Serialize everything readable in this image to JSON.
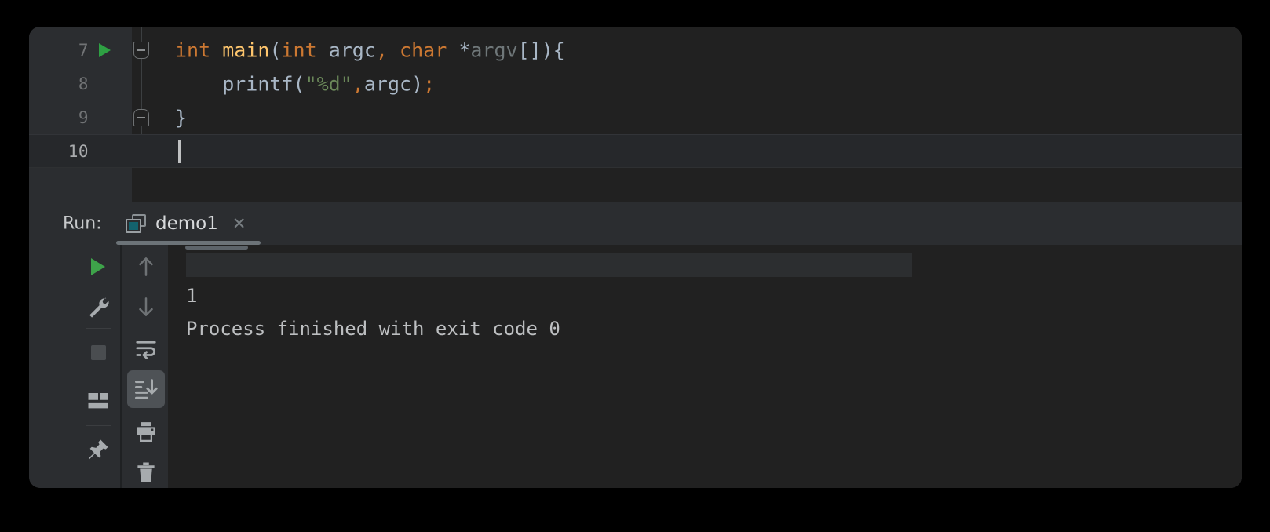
{
  "editor": {
    "lines": [
      {
        "number": "7",
        "has_run_marker": true,
        "fold": "top",
        "current": false,
        "tokens": [
          {
            "text": "int ",
            "style": "kw"
          },
          {
            "text": "main",
            "style": "fn"
          },
          {
            "text": "(",
            "style": "txt"
          },
          {
            "text": "int",
            "style": "kw"
          },
          {
            "text": " argc",
            "style": "txt"
          },
          {
            "text": ",",
            "style": "kw"
          },
          {
            "text": " ",
            "style": "txt"
          },
          {
            "text": "char",
            "style": "kw"
          },
          {
            "text": " *",
            "style": "txt"
          },
          {
            "text": "argv",
            "style": "dim"
          },
          {
            "text": "[]){",
            "style": "txt"
          }
        ]
      },
      {
        "number": "8",
        "has_run_marker": false,
        "fold": "",
        "current": false,
        "indent": 4,
        "tokens": [
          {
            "text": "    printf(",
            "style": "txt"
          },
          {
            "text": "\"%d\"",
            "style": "str"
          },
          {
            "text": ",",
            "style": "kw"
          },
          {
            "text": "argc)",
            "style": "txt"
          },
          {
            "text": ";",
            "style": "kw"
          }
        ]
      },
      {
        "number": "9",
        "has_run_marker": false,
        "fold": "bottom",
        "current": false,
        "tokens": [
          {
            "text": "}",
            "style": "txt"
          }
        ]
      },
      {
        "number": "10",
        "has_run_marker": false,
        "fold": "",
        "current": true,
        "caret": true,
        "tokens": []
      }
    ]
  },
  "run_panel": {
    "label": "Run:",
    "tab": {
      "icon": "console-icon",
      "name": "demo1",
      "close_glyph": "✕",
      "selected": true
    },
    "toolbar_left": [
      {
        "name": "rerun-button",
        "icon": "play",
        "enabled": true,
        "tooltip": "Rerun"
      },
      {
        "name": "edit-configuration-button",
        "icon": "wrench",
        "enabled": true,
        "tooltip": "Edit Configuration"
      },
      {
        "name": "stop-button",
        "icon": "stop",
        "enabled": false,
        "tooltip": "Stop"
      },
      {
        "name": "restore-layout-button",
        "icon": "layout",
        "enabled": true,
        "tooltip": "Restore Layout"
      },
      {
        "name": "pin-tab-button",
        "icon": "pin",
        "enabled": true,
        "tooltip": "Pin Tab"
      }
    ],
    "toolbar_right": [
      {
        "name": "up-button",
        "icon": "arrow-up",
        "enabled": true,
        "active": false,
        "tooltip": "Up"
      },
      {
        "name": "down-button",
        "icon": "arrow-down",
        "enabled": true,
        "active": false,
        "tooltip": "Down"
      },
      {
        "name": "soft-wrap-button",
        "icon": "soft-wrap",
        "enabled": true,
        "active": false,
        "tooltip": "Soft-Wrap"
      },
      {
        "name": "scroll-to-end-button",
        "icon": "scroll-to-end",
        "enabled": true,
        "active": true,
        "tooltip": "Scroll to the end"
      },
      {
        "name": "print-button",
        "icon": "print",
        "enabled": true,
        "active": false,
        "tooltip": "Print"
      },
      {
        "name": "clear-all-button",
        "icon": "trash",
        "enabled": true,
        "active": false,
        "tooltip": "Clear All"
      }
    ],
    "console": {
      "redacted_line": "",
      "output": "1",
      "exit_message": "Process finished with exit code 0"
    }
  },
  "colors": {
    "page_background": "#000000",
    "window_background": "#212121",
    "panel_background": "#2b2d30",
    "gutter_background": "#2b2d30",
    "keyword": "#cc7832",
    "function": "#ffc66d",
    "string": "#6a8759",
    "text": "#a9b7c6",
    "dim_text": "#6f7779",
    "console_text": "#bdbfc1",
    "run_green": "#3ea34a",
    "tab_underline": "#6c7378",
    "active_toggle": "#4e5256"
  }
}
